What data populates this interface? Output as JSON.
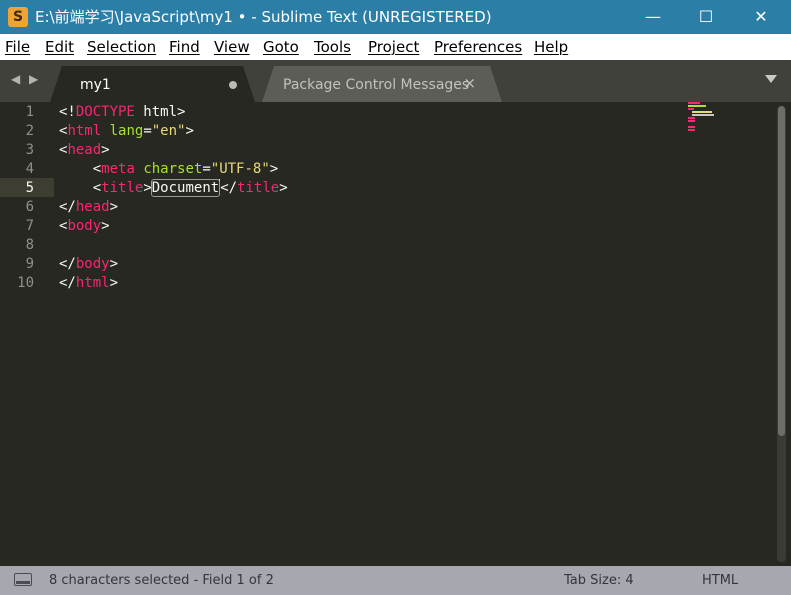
{
  "window": {
    "app_icon_letter": "S",
    "title": "E:\\前端学习\\JavaScript\\my1 • - Sublime Text (UNREGISTERED)",
    "minimize_glyph": "—",
    "maximize_glyph": "☐",
    "close_glyph": "✕"
  },
  "menu": [
    "File",
    "Edit",
    "Selection",
    "Find",
    "View",
    "Goto",
    "Tools",
    "Project",
    "Preferences",
    "Help"
  ],
  "tabs": {
    "nav_left": "◀",
    "nav_right": "▶",
    "items": [
      {
        "label": "my1",
        "active": true,
        "modified": true
      },
      {
        "label": "Package Control Messages",
        "active": false,
        "close_glyph": "×"
      }
    ]
  },
  "editor": {
    "line_numbers": [
      "1",
      "2",
      "3",
      "4",
      "5",
      "6",
      "7",
      "8",
      "9",
      "10"
    ],
    "current_line": 5,
    "line1": {
      "open": "<!",
      "doctype": "DOCTYPE",
      "rest": " html>"
    },
    "line2": {
      "open": "<",
      "tag": "html",
      "sp": " ",
      "attr": "lang",
      "eq": "=",
      "val": "\"en\"",
      "close": ">"
    },
    "line3": {
      "open": "<",
      "tag": "head",
      "close": ">"
    },
    "line4": {
      "indent": "    ",
      "open": "<",
      "tag": "meta",
      "sp": " ",
      "attr": "charset",
      "eq": "=",
      "val": "\"UTF-8\"",
      "close": ">"
    },
    "line5": {
      "indent": "    ",
      "open": "<",
      "tag": "title",
      "close": ">",
      "text": "Document",
      "open2": "</",
      "tag2": "title",
      "close2": ">"
    },
    "line6": {
      "open": "</",
      "tag": "head",
      "close": ">"
    },
    "line7": {
      "open": "<",
      "tag": "body",
      "close": ">"
    },
    "line9": {
      "open": "</",
      "tag": "body",
      "close": ">"
    },
    "line10": {
      "open": "</",
      "tag": "html",
      "close": ">"
    }
  },
  "colors": {
    "tag": "#f92672",
    "attribute": "#a6e22e",
    "string": "#e6db74",
    "text": "#f8f8f2",
    "background": "#272822",
    "titlebar": "#2b7fa6",
    "statusbar": "#a5a8ae"
  },
  "status": {
    "selection": "8 characters selected - Field 1 of 2",
    "tab_size": "Tab Size: 4",
    "syntax": "HTML"
  }
}
